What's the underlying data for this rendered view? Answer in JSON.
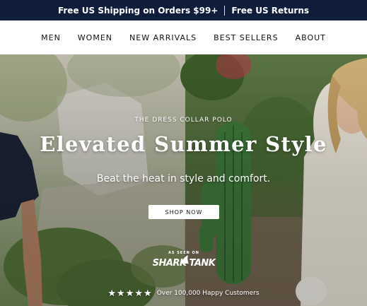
{
  "promo_bar": {
    "shipping": "Free US Shipping on Orders $99+",
    "returns": "Free US Returns"
  },
  "nav": {
    "items": [
      "MEN",
      "WOMEN",
      "NEW ARRIVALS",
      "BEST SELLERS",
      "ABOUT"
    ]
  },
  "hero": {
    "eyebrow": "THE DRESS COLLAR POLO",
    "headline": "Elevated Summer Style",
    "subhead": "Beat the heat in style and comfort.",
    "cta_label": "SHOP NOW",
    "badge": {
      "as_seen_on": "AS SEEN ON",
      "wordmark": "SHARK TANK"
    },
    "rating": {
      "stars": "★★★★★",
      "text": "Over 100,000 Happy Customers"
    }
  },
  "colors": {
    "promo_bg": "#0f1d3a",
    "text_on_image": "#ffffff",
    "cta_bg": "#ffffff"
  },
  "icons": [
    "star-icon",
    "shark-fin-icon"
  ]
}
